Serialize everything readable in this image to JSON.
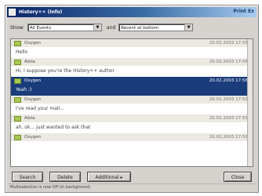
{
  "window": {
    "title": "History++ (Info)",
    "title_right": "Print Ex"
  },
  "filter": {
    "show_label": "Show:",
    "show_value": "All Events",
    "and_label": "and",
    "order_value": "Recent at bottom"
  },
  "messages": [
    {
      "sender": "Oxygen",
      "time": "20.02.2003 17:56",
      "text": "Hello"
    },
    {
      "sender": "Alela",
      "time": "20.02.2003 17:56",
      "text": "Hi, I suppose you're the History++ author"
    },
    {
      "sender": "Oxygen",
      "time": "20.02.2003 17:56",
      "text": "Yeah :)",
      "selected": true
    },
    {
      "sender": "Oxygen",
      "time": "20.02.2003 17:59",
      "text": "I've read your mail..."
    },
    {
      "sender": "Alela",
      "time": "20.02.2003 17:59",
      "text": "ah, ok... just wanted to ask that"
    },
    {
      "sender": "Oxygen",
      "time": "20.02.2003 17:59"
    }
  ],
  "buttons": {
    "search": "Search",
    "delete": "Delete",
    "additional": "Additional ▸",
    "close": "Close"
  },
  "status": "Multiselection is now Off (in background)",
  "colors": {
    "selection": "#1a3c7a",
    "titlebar": "#0a246a",
    "avatar": "#a8c850"
  }
}
